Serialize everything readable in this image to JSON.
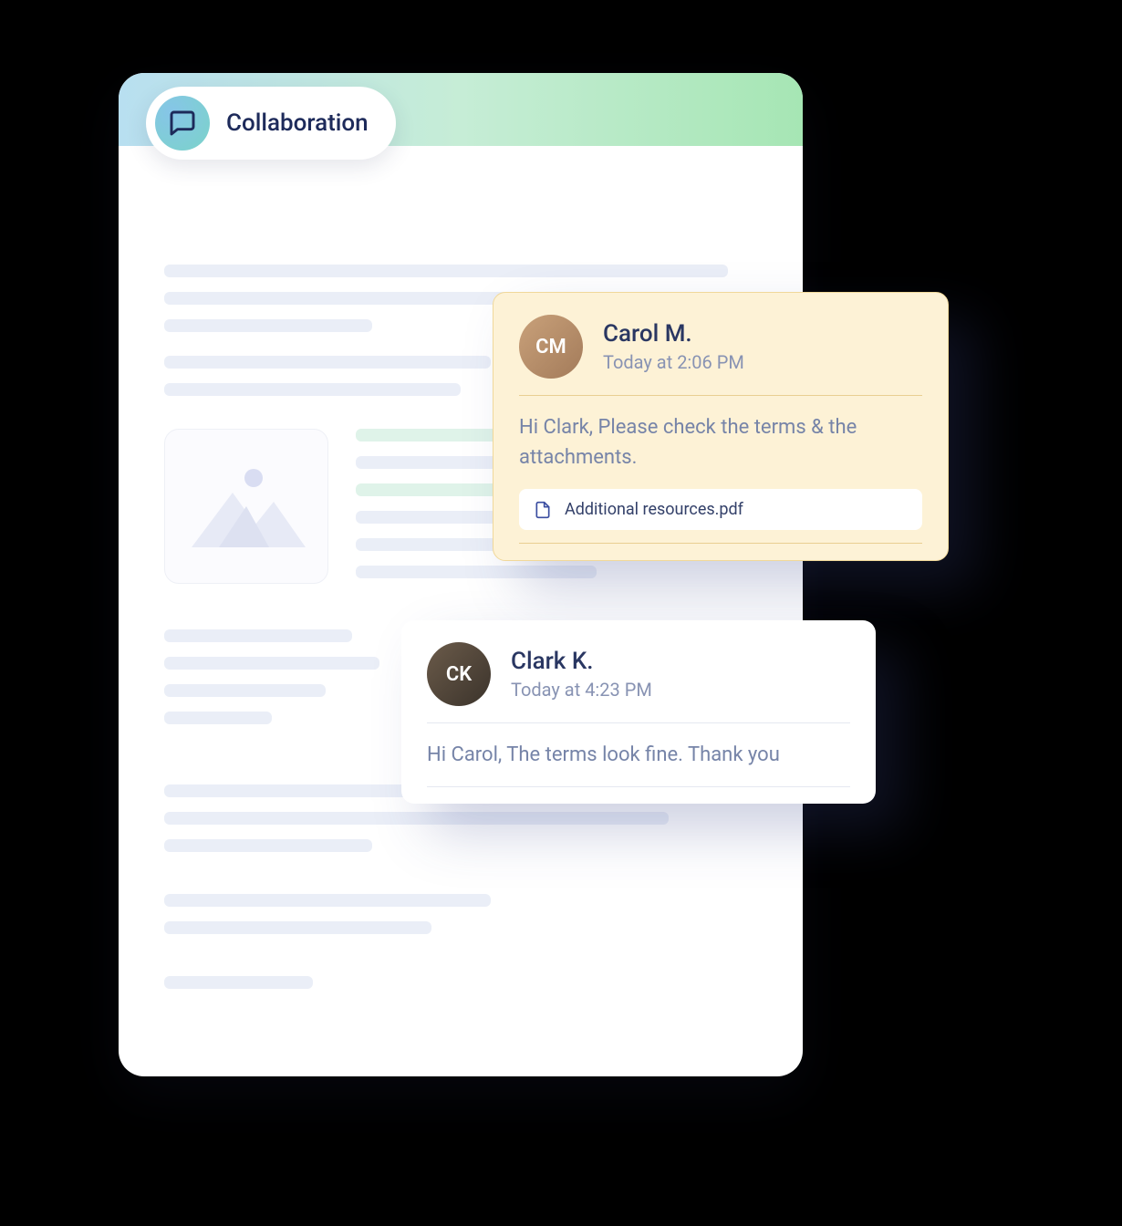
{
  "pill": {
    "label": "Collaboration"
  },
  "comments": [
    {
      "author": "Carol M.",
      "initials": "CM",
      "time": "Today at 2:06 PM",
      "message": "Hi Clark, Please check the terms & the attachments.",
      "attachment": "Additional resources.pdf"
    },
    {
      "author": "Clark K.",
      "initials": "CK",
      "time": "Today at 4:23 PM",
      "message": "Hi Carol, The terms look fine. Thank you"
    }
  ]
}
